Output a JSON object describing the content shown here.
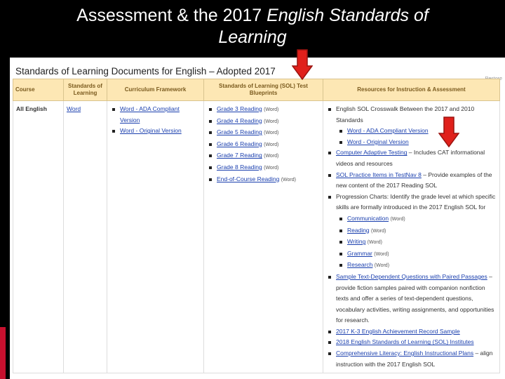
{
  "slide": {
    "title_plain": "Assessment & the 2017 ",
    "title_italic_1": "English Standards of",
    "title_italic_2": "Learning"
  },
  "page": {
    "heading": "Standards of Learning Documents for English – Adopted 2017",
    "restore_label": "Restore"
  },
  "table": {
    "headers": [
      "Course",
      "Standards of Learning",
      "Curriculum Framework",
      "Standards of Learning (SOL) Test Blueprints",
      "Resources for Instruction & Assessment"
    ],
    "course": "All English",
    "sol_link": "Word",
    "framework": [
      {
        "link": "Word - ADA Compliant Version"
      },
      {
        "link": "Word - Original Version"
      }
    ],
    "blueprints": [
      {
        "link": "Grade 3 Reading",
        "note": "(Word)"
      },
      {
        "link": "Grade 4 Reading",
        "note": "(Word)"
      },
      {
        "link": "Grade 5 Reading",
        "note": "(Word)"
      },
      {
        "link": "Grade 6 Reading",
        "note": "(Word)"
      },
      {
        "link": "Grade 7 Reading",
        "note": "(Word)"
      },
      {
        "link": "Grade 8 Reading",
        "note": "(Word)"
      },
      {
        "link": "End-of-Course Reading",
        "note": "(Word)"
      }
    ],
    "resources": {
      "crosswalk": "English SOL Crosswalk Between the 2017 and 2010 Standards",
      "crosswalk_sub": [
        "Word - ADA Compliant Version",
        "Word - Original Version"
      ],
      "cat_link": "Computer Adaptive Testing",
      "cat_text": " – Includes CAT informational videos and resources",
      "practice_link": "SOL Practice Items in TestNav 8",
      "practice_text": " – Provide examples of the new content of the 2017 Reading SOL",
      "progression": "Progression Charts: Identify the grade level at which specific skills are formally introduced in the 2017 English SOL for",
      "progression_sub": [
        {
          "link": "Communication",
          "note": "(Word)"
        },
        {
          "link": "Reading",
          "note": "(Word)"
        },
        {
          "link": "Writing",
          "note": "(Word)"
        },
        {
          "link": "Grammar",
          "note": "(Word)"
        },
        {
          "link": "Research",
          "note": "(Word)"
        }
      ],
      "sample_link": "Sample Text-Dependent Questions with Paired Passages",
      "sample_text": " – provide fiction samples paired with companion nonfiction texts and offer a series of text-dependent questions, vocabulary activities, writing assignments, and opportunities for research.",
      "k3_link": "2017 K-3 English Achievement Record Sample",
      "institutes_link": "2018 English Standards of Learning (SOL) Institutes",
      "plans_link": "Comprehensive Literacy: English Instructional Plans",
      "plans_text": " – align instruction with the 2017 English SOL"
    }
  },
  "colors": {
    "arrow": "#e0201b",
    "header_bg": "#fde7b4",
    "link": "#1a3fae"
  }
}
